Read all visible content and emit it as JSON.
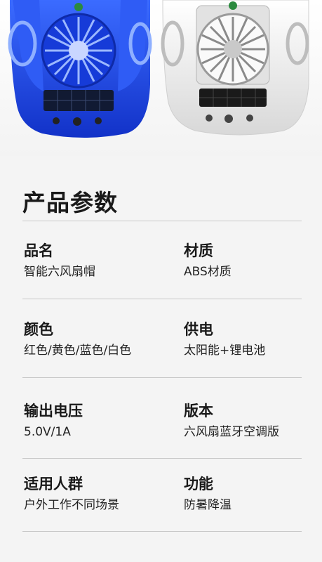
{
  "hero": {
    "image_alt": "blue and white six-fan solar helmets",
    "colors": {
      "blue": "#1b47e6",
      "white": "#f0f0f0"
    }
  },
  "section_title": "产品参数",
  "specs": [
    {
      "label": "品名",
      "value": "智能六风扇帽"
    },
    {
      "label": "材质",
      "value": "ABS材质"
    },
    {
      "label": "颜色",
      "value": "红色/黄色/蓝色/白色"
    },
    {
      "label": "供电",
      "value": "太阳能+锂电池"
    },
    {
      "label": "输出电压",
      "value": "5.0V/1A"
    },
    {
      "label": "版本",
      "value": "六风扇蓝牙空调版"
    },
    {
      "label": "适用人群",
      "value": "户外工作不同场景"
    },
    {
      "label": "功能",
      "value": "防暑降温"
    }
  ]
}
